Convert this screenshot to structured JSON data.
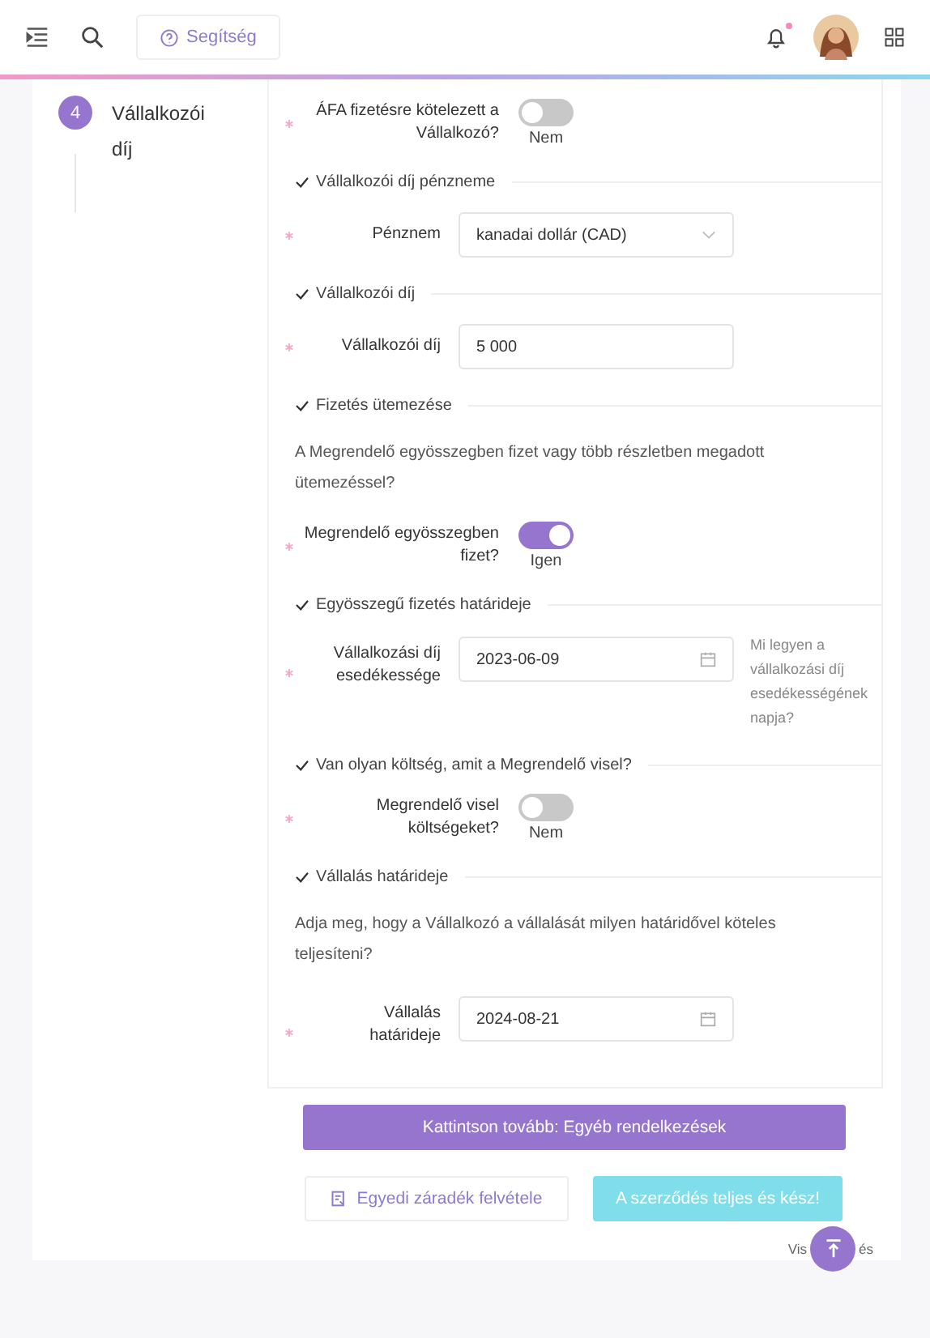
{
  "header": {
    "help_button": "Segítség",
    "notification_dot": true
  },
  "step": {
    "number": "4",
    "label": "Vállalkozói díj"
  },
  "sections": [
    {
      "fields": [
        {
          "kind": "toggle",
          "label": "ÁFA fizetésre kötelezett a Vállalkozó?",
          "required": true,
          "on": false,
          "state_text": "Nem"
        }
      ]
    },
    {
      "title": "Vállalkozói díj pénzneme",
      "fields": [
        {
          "kind": "select",
          "label": "Pénznem",
          "required": true,
          "value": "kanadai dollár (CAD)"
        }
      ]
    },
    {
      "title": "Vállalkozói díj",
      "fields": [
        {
          "kind": "input",
          "label": "Vállalkozói díj",
          "required": true,
          "value": "5 000"
        }
      ]
    },
    {
      "title": "Fizetés ütemezése",
      "description": "A Megrendelő egyösszegben fizet vagy több részletben megadott ütemezéssel?",
      "fields": [
        {
          "kind": "toggle",
          "label": "Megrendelő egyösszegben fizet?",
          "required": true,
          "on": true,
          "state_text": "Igen"
        }
      ]
    },
    {
      "title": "Egyösszegű fizetés határideje",
      "fields": [
        {
          "kind": "date",
          "label": "Vállalkozási díj esedékessége",
          "required": true,
          "value": "2023-06-09",
          "hint": "Mi legyen a vállalkozási díj esedékességének napja?"
        }
      ]
    },
    {
      "title": "Van olyan költség, amit a Megrendelő visel?",
      "fields": [
        {
          "kind": "toggle",
          "label": "Megrendelő visel költségeket?",
          "required": true,
          "on": false,
          "state_text": "Nem"
        }
      ]
    },
    {
      "title": "Vállalás határideje",
      "description": "Adja meg, hogy a Vállalkozó a vállalását milyen határidővel köteles teljesíteni?",
      "fields": [
        {
          "kind": "date",
          "label": "Vállalás határideje",
          "required": true,
          "value": "2024-08-21"
        }
      ]
    }
  ],
  "next_button": "Kattintson tovább: Egyéb rendelkezések",
  "clause_button": "Egyedi záradék felvétele",
  "done_button": "A szerződés teljes és kész!",
  "covered_link": [
    "Vis",
    "és"
  ]
}
